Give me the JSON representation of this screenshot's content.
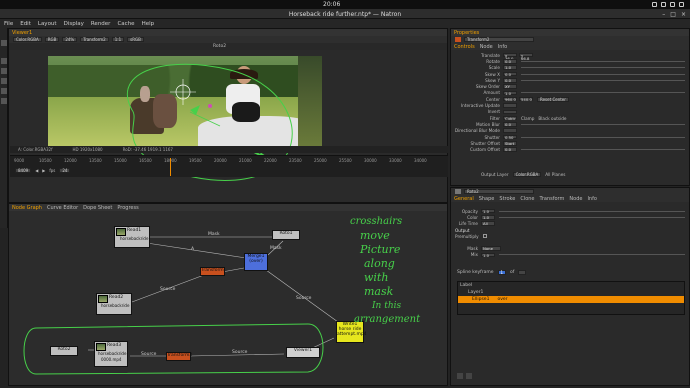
{
  "system": {
    "clock": "20:06"
  },
  "window": {
    "title": "Horseback ride further.ntp* — Natron"
  },
  "menu": [
    "File",
    "Edit",
    "Layout",
    "Display",
    "Render",
    "Cache",
    "Help"
  ],
  "viewer": {
    "tab": "Viewer1",
    "layer": "Color.RGBA",
    "channel": "RGB",
    "zoom": "24%",
    "input_a": "Transform2",
    "proxy": "1:1",
    "colorspace": "sRGB",
    "roto_label": "Roto2",
    "status_left": "A: Color.RGBA32f",
    "status_mid": "HD 1920x1080",
    "status_right": "RoD: -37.46 1919.1 1167"
  },
  "timeline": {
    "ticks": [
      "9000",
      "10500",
      "12000",
      "13500",
      "15000",
      "16500",
      "18000",
      "19500",
      "20000",
      "21000",
      "22000",
      "23500",
      "25000",
      "25500",
      "30000",
      "33000",
      "34000"
    ],
    "current_frame": "8409",
    "fps": "24"
  },
  "nodegraph": {
    "tabs": [
      "Node Graph",
      "Curve Editor",
      "Dope Sheet",
      "Progress"
    ],
    "nodes": {
      "read1": "Read1",
      "read1_sub": "horsebackride",
      "read2": "Read2",
      "read2_sub": "horsebackride",
      "read3": "Read3",
      "read3_sub": "horsebackride",
      "read3_file": "0000.mp4",
      "transform": "Transform",
      "transform2": "Transform2",
      "merge": "Merge1",
      "merge_sub": "(over)",
      "roto1": "Roto1",
      "roto2": "Roto2",
      "write": "Write1",
      "write_sub": "horse ride",
      "write_file": "attempt.mp4",
      "viewer": "Viewer1"
    },
    "edge_labels": {
      "mask_top": "Mask",
      "mask_side": "Mask",
      "a": "A",
      "source1": "Source",
      "source2": "Source",
      "source3": "Source",
      "source4": "Source"
    }
  },
  "annotation": [
    "crosshairs",
    "move",
    "Picture",
    "along",
    "with",
    "mask",
    "In this",
    "arrangement"
  ],
  "properties": {
    "header": "Properties",
    "node_name": "Transform2",
    "tabs": [
      "Controls",
      "Node",
      "Info"
    ],
    "rows": [
      {
        "label": "Translate",
        "x": "x 36.0",
        "y": "y 66.8"
      },
      {
        "label": "Rotate",
        "x": "0.0"
      },
      {
        "label": "Scale",
        "x": "1.0"
      },
      {
        "label": "Skew X",
        "x": "0.0"
      },
      {
        "label": "Skew Y",
        "x": "0.0"
      },
      {
        "label": "Skew Order",
        "x": "XY"
      },
      {
        "label": "Amount",
        "x": "1.0"
      },
      {
        "label": "Center",
        "x": "960.0",
        "y": "540.0"
      },
      {
        "label": "Interactive Update",
        "x": ""
      },
      {
        "label": "Invert",
        "x": ""
      },
      {
        "label": "Filter",
        "x": "Cubic"
      },
      {
        "label": "Motion Blur",
        "x": "0.0"
      },
      {
        "label": "Directional Blur Mode",
        "x": ""
      },
      {
        "label": "Shutter",
        "x": "0.50"
      },
      {
        "label": "Shutter Offset",
        "x": "Start"
      },
      {
        "label": "Custom Offset",
        "x": "0.0"
      }
    ],
    "filter_extra": [
      "Clamp",
      "Black outside"
    ],
    "reset_center": "Reset Center",
    "output_layer_label": "Output Layer",
    "output_layer_value": "Color.RGBA",
    "all_planes": "All Planes"
  },
  "roto": {
    "node_name": "Roto2",
    "tabs": [
      "General",
      "Shape",
      "Stroke",
      "Clone",
      "Transform",
      "Node",
      "Info"
    ],
    "rows": [
      {
        "label": "Opacity",
        "val": "1.0"
      },
      {
        "label": "Color",
        "val": "1.0"
      },
      {
        "label": "Life Time",
        "val": "All"
      }
    ],
    "output_label": "Output",
    "premultiply_label": "Premultiply",
    "mask_label": "Mask",
    "mask_val": "None",
    "mix_label": "Mix",
    "mix_val": "1.0",
    "spline_label": "Spline keyframe",
    "spline_val": "1",
    "spline_of": "of",
    "label_header": "Label",
    "layer_name": "Layer1",
    "ellipse_name": "Ellipse1",
    "ellipse_mode": "over"
  },
  "colors": {
    "accent": "#f08c00",
    "annotation": "#47d04a",
    "node_yellow": "#e6e61e",
    "node_blue": "#4d6fdc",
    "node_orange": "#c8501e"
  }
}
